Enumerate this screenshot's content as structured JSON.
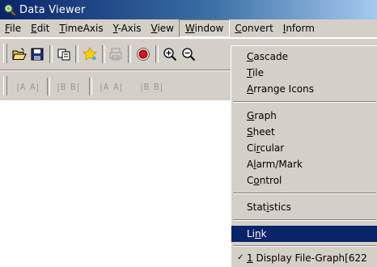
{
  "window": {
    "title": "Data Viewer"
  },
  "menubar": {
    "items": [
      {
        "pre": "",
        "key": "F",
        "post": "ile"
      },
      {
        "pre": "",
        "key": "E",
        "post": "dit"
      },
      {
        "pre": "",
        "key": "T",
        "post": "imeAxis"
      },
      {
        "pre": "",
        "key": "Y",
        "post": "-Axis"
      },
      {
        "pre": "",
        "key": "V",
        "post": "iew"
      },
      {
        "pre": "",
        "key": "W",
        "post": "indow"
      },
      {
        "pre": "",
        "key": "C",
        "post": "onvert"
      },
      {
        "pre": "",
        "key": "I",
        "post": "nform"
      }
    ]
  },
  "toolbar2": {
    "buttons": [
      "|A A|",
      "|B B|",
      "|A A|",
      "|B B|"
    ]
  },
  "window_menu": {
    "items": [
      {
        "pre": "",
        "key": "C",
        "post": "ascade"
      },
      {
        "pre": "",
        "key": "T",
        "post": "ile"
      },
      {
        "pre": "",
        "key": "A",
        "post": "rrange Icons"
      },
      {
        "pre": "",
        "key": "G",
        "post": "raph"
      },
      {
        "pre": "",
        "key": "S",
        "post": "heet"
      },
      {
        "pre": "Ci",
        "key": "r",
        "post": "cular"
      },
      {
        "pre": "A",
        "key": "l",
        "post": "arm/Mark"
      },
      {
        "pre": "C",
        "key": "o",
        "post": "ntrol"
      },
      {
        "pre": "Stat",
        "key": "i",
        "post": "stics"
      },
      {
        "pre": "Li",
        "key": "n",
        "post": "k"
      },
      {
        "pre": "",
        "key": "1",
        "post": " Display File-Graph[622"
      }
    ],
    "check_mark": "✓"
  },
  "colors": {
    "title_bar": "#0a246a",
    "menu_bg": "#d4d0c8",
    "highlight": "#0a246a"
  }
}
